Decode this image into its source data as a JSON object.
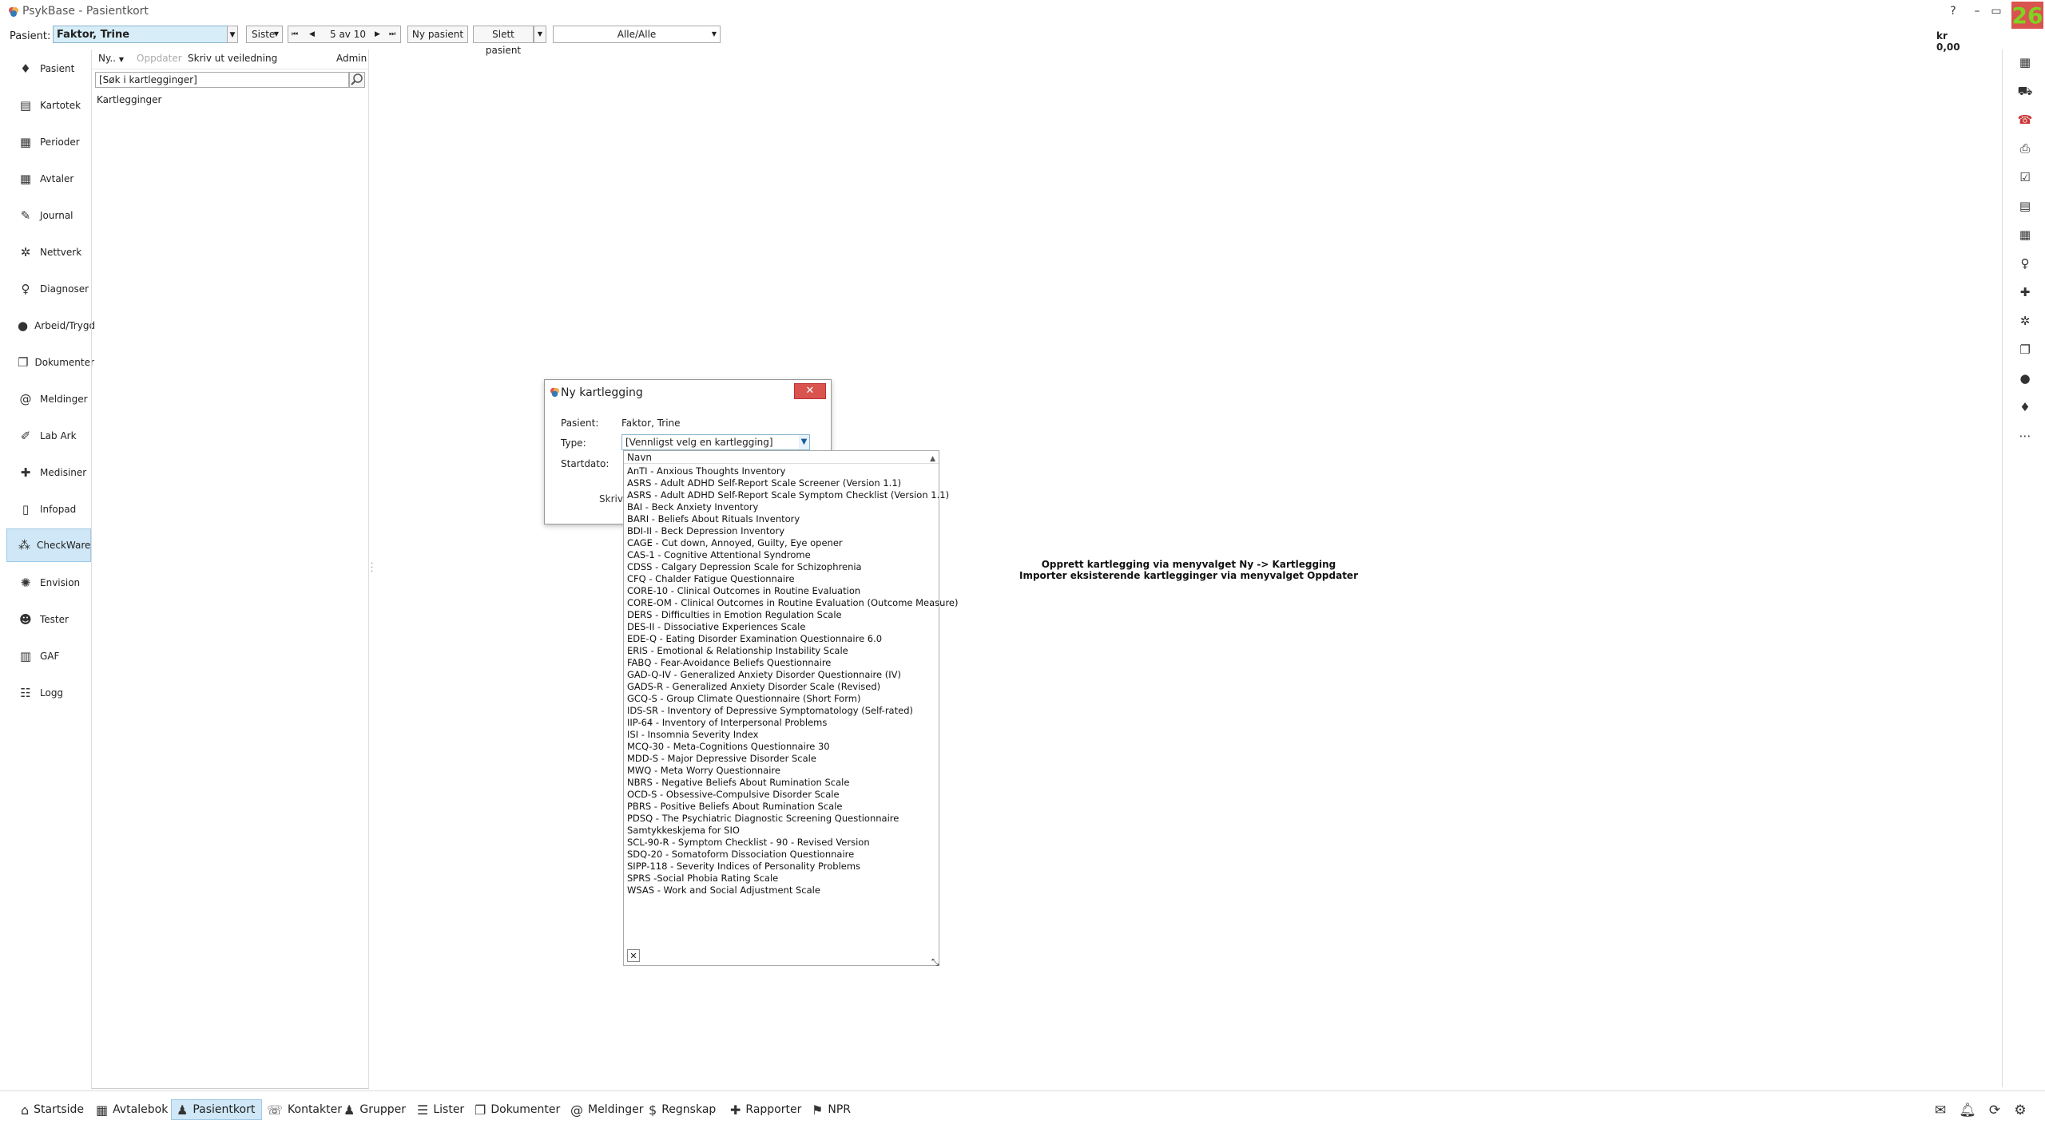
{
  "window": {
    "title": "PsykBase - Pasientkort",
    "badge": "26"
  },
  "toolbar": {
    "patient_label": "Pasient:",
    "patient_value": "Faktor, Trine",
    "siste_label": "Siste",
    "nav_position": "5 av 10",
    "ny_pasient": "Ny pasient",
    "slett_pasient": "Slett pasient",
    "filter_value": "Alle/Alle",
    "balance": "kr 0,00",
    "help": "?"
  },
  "leftnav": {
    "items": [
      {
        "label": "Pasient"
      },
      {
        "label": "Kartotek"
      },
      {
        "label": "Perioder"
      },
      {
        "label": "Avtaler"
      },
      {
        "label": "Journal"
      },
      {
        "label": "Nettverk"
      },
      {
        "label": "Diagnoser"
      },
      {
        "label": "Arbeid/Trygd"
      },
      {
        "label": "Dokumenter"
      },
      {
        "label": "Meldinger"
      },
      {
        "label": "Lab Ark"
      },
      {
        "label": "Medisiner"
      },
      {
        "label": "Infopad"
      },
      {
        "label": "CheckWare"
      },
      {
        "label": "Envision"
      },
      {
        "label": "Tester"
      },
      {
        "label": "GAF"
      },
      {
        "label": "Logg"
      }
    ]
  },
  "midpanel": {
    "menu": {
      "ny": "Ny..",
      "oppdater": "Oppdater",
      "skriv": "Skriv ut veiledning",
      "admin": "Admin"
    },
    "search_placeholder": "[Søk i kartlegginger]",
    "list_label": "Kartlegginger"
  },
  "center_message": {
    "line1": "Opprett kartlegging via menyvalget Ny -> Kartlegging",
    "line2": "Importer eksisterende kartlegginger via menyvalget Oppdater"
  },
  "dialog": {
    "title": "Ny kartlegging",
    "pasient_label": "Pasient:",
    "pasient_value": "Faktor, Trine",
    "type_label": "Type:",
    "type_value": "[Vennligst velg en kartlegging]",
    "startdato_label": "Startdato:",
    "skriv_stub": "Skriv u"
  },
  "dropdown": {
    "header": "Navn",
    "clear": "✕",
    "items": [
      "AnTI - Anxious Thoughts Inventory",
      "ASRS - Adult ADHD Self-Report Scale Screener (Version 1.1)",
      "ASRS - Adult ADHD Self-Report Scale Symptom Checklist (Version 1.1)",
      "BAI - Beck Anxiety Inventory",
      "BARI - Beliefs About Rituals Inventory",
      "BDI-II - Beck Depression Inventory",
      "CAGE - Cut down, Annoyed, Guilty, Eye opener",
      "CAS-1 - Cognitive Attentional Syndrome",
      "CDSS - Calgary Depression Scale for Schizophrenia",
      "CFQ - Chalder Fatigue Questionnaire",
      "CORE-10 - Clinical Outcomes in Routine Evaluation",
      "CORE-OM - Clinical Outcomes in Routine Evaluation (Outcome Measure)",
      "DERS - Difficulties in Emotion Regulation Scale",
      "DES-II - Dissociative Experiences Scale",
      "EDE-Q - Eating Disorder Examination Questionnaire 6.0",
      "ERIS - Emotional & Relationship Instability Scale",
      "FABQ - Fear-Avoidance Beliefs Questionnaire",
      "GAD-Q-IV - Generalized Anxiety Disorder Questionnaire (IV)",
      "GADS-R - Generalized Anxiety Disorder Scale (Revised)",
      "GCQ-S - Group Climate Questionnaire (Short Form)",
      "IDS-SR - Inventory of Depressive Symptomatology (Self-rated)",
      "IIP-64 - Inventory of Interpersonal Problems",
      "ISI - Insomnia Severity Index",
      "MCQ-30 - Meta-Cognitions Questionnaire 30",
      "MDD-S - Major Depressive Disorder Scale",
      "MWQ - Meta Worry Questionnaire",
      "NBRS - Negative Beliefs About Rumination Scale",
      "OCD-S - Obsessive-Compulsive Disorder Scale",
      "PBRS - Positive Beliefs About Rumination Scale",
      "PDSQ - The Psychiatric Diagnostic Screening Questionnaire",
      "Samtykkeskjema for SIO",
      "SCL-90-R - Symptom Checklist - 90 - Revised Version",
      "SDQ-20 - Somatoform Dissociation Questionnaire",
      "SIPP-118 - Severity Indices of Personality Problems",
      "SPRS -Social Phobia Rating Scale",
      "WSAS - Work and Social Adjustment Scale"
    ]
  },
  "bottombar": {
    "items": [
      {
        "label": "Startside"
      },
      {
        "label": "Avtalebok"
      },
      {
        "label": "Pasientkort"
      },
      {
        "label": "Kontakter"
      },
      {
        "label": "Grupper"
      },
      {
        "label": "Lister"
      },
      {
        "label": "Dokumenter"
      },
      {
        "label": "Meldinger"
      },
      {
        "label": "Regnskap"
      },
      {
        "label": "Rapporter"
      },
      {
        "label": "NPR"
      }
    ]
  }
}
